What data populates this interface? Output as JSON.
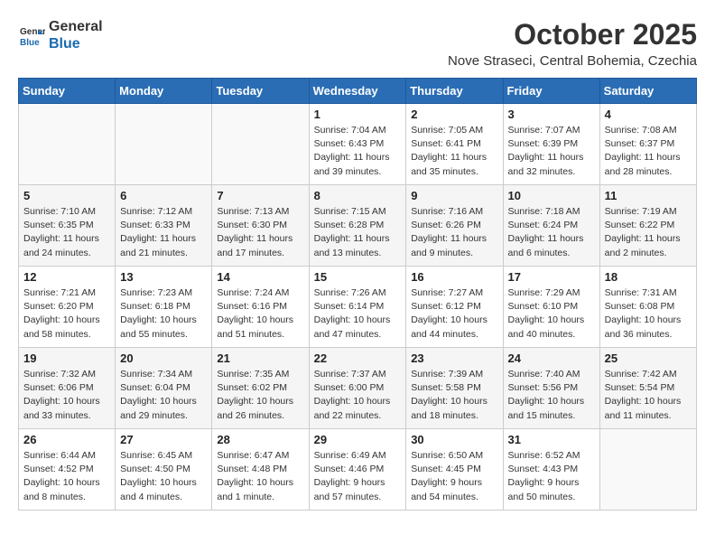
{
  "logo": {
    "line1": "General",
    "line2": "Blue"
  },
  "title": "October 2025",
  "location": "Nove Straseci, Central Bohemia, Czechia",
  "days_header": [
    "Sunday",
    "Monday",
    "Tuesday",
    "Wednesday",
    "Thursday",
    "Friday",
    "Saturday"
  ],
  "weeks": [
    [
      {
        "day": "",
        "info": ""
      },
      {
        "day": "",
        "info": ""
      },
      {
        "day": "",
        "info": ""
      },
      {
        "day": "1",
        "info": "Sunrise: 7:04 AM\nSunset: 6:43 PM\nDaylight: 11 hours\nand 39 minutes."
      },
      {
        "day": "2",
        "info": "Sunrise: 7:05 AM\nSunset: 6:41 PM\nDaylight: 11 hours\nand 35 minutes."
      },
      {
        "day": "3",
        "info": "Sunrise: 7:07 AM\nSunset: 6:39 PM\nDaylight: 11 hours\nand 32 minutes."
      },
      {
        "day": "4",
        "info": "Sunrise: 7:08 AM\nSunset: 6:37 PM\nDaylight: 11 hours\nand 28 minutes."
      }
    ],
    [
      {
        "day": "5",
        "info": "Sunrise: 7:10 AM\nSunset: 6:35 PM\nDaylight: 11 hours\nand 24 minutes."
      },
      {
        "day": "6",
        "info": "Sunrise: 7:12 AM\nSunset: 6:33 PM\nDaylight: 11 hours\nand 21 minutes."
      },
      {
        "day": "7",
        "info": "Sunrise: 7:13 AM\nSunset: 6:30 PM\nDaylight: 11 hours\nand 17 minutes."
      },
      {
        "day": "8",
        "info": "Sunrise: 7:15 AM\nSunset: 6:28 PM\nDaylight: 11 hours\nand 13 minutes."
      },
      {
        "day": "9",
        "info": "Sunrise: 7:16 AM\nSunset: 6:26 PM\nDaylight: 11 hours\nand 9 minutes."
      },
      {
        "day": "10",
        "info": "Sunrise: 7:18 AM\nSunset: 6:24 PM\nDaylight: 11 hours\nand 6 minutes."
      },
      {
        "day": "11",
        "info": "Sunrise: 7:19 AM\nSunset: 6:22 PM\nDaylight: 11 hours\nand 2 minutes."
      }
    ],
    [
      {
        "day": "12",
        "info": "Sunrise: 7:21 AM\nSunset: 6:20 PM\nDaylight: 10 hours\nand 58 minutes."
      },
      {
        "day": "13",
        "info": "Sunrise: 7:23 AM\nSunset: 6:18 PM\nDaylight: 10 hours\nand 55 minutes."
      },
      {
        "day": "14",
        "info": "Sunrise: 7:24 AM\nSunset: 6:16 PM\nDaylight: 10 hours\nand 51 minutes."
      },
      {
        "day": "15",
        "info": "Sunrise: 7:26 AM\nSunset: 6:14 PM\nDaylight: 10 hours\nand 47 minutes."
      },
      {
        "day": "16",
        "info": "Sunrise: 7:27 AM\nSunset: 6:12 PM\nDaylight: 10 hours\nand 44 minutes."
      },
      {
        "day": "17",
        "info": "Sunrise: 7:29 AM\nSunset: 6:10 PM\nDaylight: 10 hours\nand 40 minutes."
      },
      {
        "day": "18",
        "info": "Sunrise: 7:31 AM\nSunset: 6:08 PM\nDaylight: 10 hours\nand 36 minutes."
      }
    ],
    [
      {
        "day": "19",
        "info": "Sunrise: 7:32 AM\nSunset: 6:06 PM\nDaylight: 10 hours\nand 33 minutes."
      },
      {
        "day": "20",
        "info": "Sunrise: 7:34 AM\nSunset: 6:04 PM\nDaylight: 10 hours\nand 29 minutes."
      },
      {
        "day": "21",
        "info": "Sunrise: 7:35 AM\nSunset: 6:02 PM\nDaylight: 10 hours\nand 26 minutes."
      },
      {
        "day": "22",
        "info": "Sunrise: 7:37 AM\nSunset: 6:00 PM\nDaylight: 10 hours\nand 22 minutes."
      },
      {
        "day": "23",
        "info": "Sunrise: 7:39 AM\nSunset: 5:58 PM\nDaylight: 10 hours\nand 18 minutes."
      },
      {
        "day": "24",
        "info": "Sunrise: 7:40 AM\nSunset: 5:56 PM\nDaylight: 10 hours\nand 15 minutes."
      },
      {
        "day": "25",
        "info": "Sunrise: 7:42 AM\nSunset: 5:54 PM\nDaylight: 10 hours\nand 11 minutes."
      }
    ],
    [
      {
        "day": "26",
        "info": "Sunrise: 6:44 AM\nSunset: 4:52 PM\nDaylight: 10 hours\nand 8 minutes."
      },
      {
        "day": "27",
        "info": "Sunrise: 6:45 AM\nSunset: 4:50 PM\nDaylight: 10 hours\nand 4 minutes."
      },
      {
        "day": "28",
        "info": "Sunrise: 6:47 AM\nSunset: 4:48 PM\nDaylight: 10 hours\nand 1 minute."
      },
      {
        "day": "29",
        "info": "Sunrise: 6:49 AM\nSunset: 4:46 PM\nDaylight: 9 hours\nand 57 minutes."
      },
      {
        "day": "30",
        "info": "Sunrise: 6:50 AM\nSunset: 4:45 PM\nDaylight: 9 hours\nand 54 minutes."
      },
      {
        "day": "31",
        "info": "Sunrise: 6:52 AM\nSunset: 4:43 PM\nDaylight: 9 hours\nand 50 minutes."
      },
      {
        "day": "",
        "info": ""
      }
    ]
  ]
}
